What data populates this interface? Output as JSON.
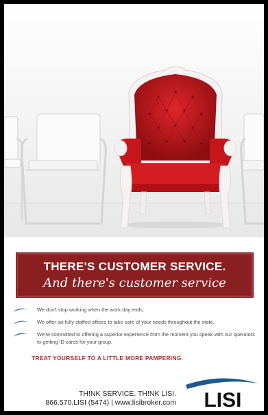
{
  "banner": {
    "headline": "THERE'S CUSTOMER SERVICE.",
    "subline": "And there's customer service"
  },
  "bullets": [
    "We don't stop working when the work day ends.",
    "We offer six fully staffed offices to take care of your needs throughout the state.",
    "We're committed to offering a superior experience from the moment you speak with our operators to getting ID cards for your group."
  ],
  "tagline": "TREAT YOURSELF TO A LITTLE MORE PAMPERING.",
  "footer": {
    "slogan": "TH!NK SERVICE. TH!NK LISI.",
    "contact": "866.570.LISI (5474) | www.lisibroker.com"
  },
  "logo": {
    "text": "LISI"
  },
  "colors": {
    "accent_red": "#b3282d",
    "banner_red": "#8a1f22",
    "swoosh_blue": "#1f5a8f"
  }
}
